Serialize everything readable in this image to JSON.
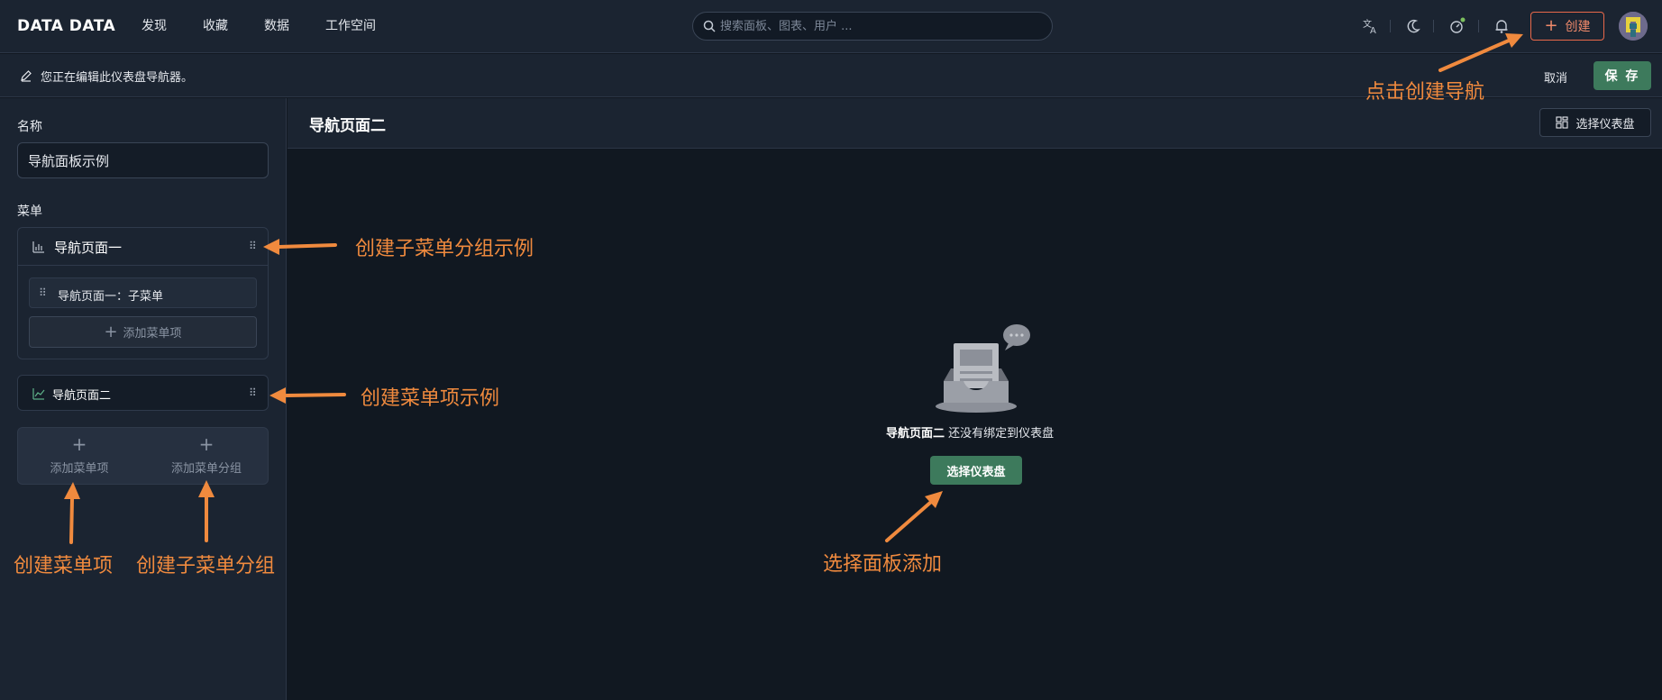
{
  "app": {
    "logo": "DATA DATA",
    "nav": [
      "发现",
      "收藏",
      "数据",
      "工作空间"
    ],
    "search_placeholder": "搜索面板、图表、用户 ...",
    "create_label": "创建",
    "icons": [
      "translate-icon",
      "moon-icon",
      "speed-icon",
      "bell-icon"
    ]
  },
  "editbar": {
    "message": "您正在编辑此仪表盘导航器。",
    "cancel": "取消",
    "save": "保 存"
  },
  "left": {
    "name_label": "名称",
    "name_value": "导航面板示例",
    "menu_label": "菜单",
    "group_title": "导航页面一",
    "sub_item": "导航页面一：子菜单",
    "add_item": "添加菜单项",
    "item_title": "导航页面二",
    "add_menu_item": "添加菜单项",
    "add_menu_group": "添加菜单分组"
  },
  "main": {
    "title": "导航页面二",
    "pick_top": "选择仪表盘",
    "empty_bold": "导航页面二",
    "empty_rest": " 还没有绑定到仪表盘",
    "pick_button": "选择仪表盘"
  },
  "annotations": {
    "create_nav": "点击创建导航",
    "submenu_group_example": "创建子菜单分组示例",
    "menu_item_example": "创建菜单项示例",
    "create_menu_item": "创建菜单项",
    "create_submenu_group": "创建子菜单分组",
    "pick_panel": "选择面板添加"
  },
  "colors": {
    "accent_green": "#3d7a5c",
    "create_orange": "#e8684a",
    "annotation_orange": "#f08a3e",
    "background": "#111821",
    "panel": "#1b2431"
  }
}
